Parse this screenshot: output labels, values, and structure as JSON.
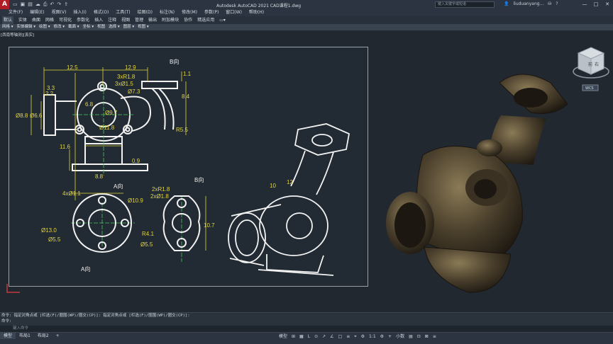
{
  "titlebar": {
    "logo": "A",
    "app_title": "Autodesk AutoCAD 2021    CAD课程1.dwg",
    "search_placeholder": "键入关键字或短语",
    "user": "liuduanyang...",
    "window_buttons": [
      "—",
      "□",
      "✕"
    ]
  },
  "menubar": {
    "items": [
      "文件(F)",
      "编辑(E)",
      "视图(V)",
      "插入(I)",
      "格式(O)",
      "工具(T)",
      "绘图(D)",
      "标注(N)",
      "修改(M)",
      "参数(P)",
      "窗口(W)",
      "帮助(H)"
    ]
  },
  "ribbon": {
    "tabs": [
      "默认",
      "实体",
      "曲面",
      "网格",
      "可视化",
      "参数化",
      "插入",
      "注释",
      "视图",
      "管理",
      "输出",
      "附加模块",
      "协作",
      "精选应用"
    ]
  },
  "toolstrip": {
    "items": [
      "网格 ▾",
      "实体编辑 ▾",
      "绘图 ▾",
      "修改 ▾",
      "截面 ▾",
      "坐标 ▾",
      "视图",
      "选择 ▾",
      "图层 ▾",
      "视图 ▾"
    ]
  },
  "viewport": {
    "label": "[西南等轴测][真实]",
    "viewcube": {
      "top": "上",
      "front": "前",
      "right": "右",
      "wcs": "WCS"
    }
  },
  "drawing": {
    "dims": {
      "d12_5": "12.5",
      "d12_9": "12.9",
      "b_view": "B向",
      "d1_1": "1.1",
      "d3xr18": "3xR1.8",
      "d3xd15": "3xØ1.5",
      "d7_3": "Ø7.3",
      "d3_3": "3.3",
      "d2_2": "2.2",
      "d6_8": "6.8",
      "d9_7": "Ø9.7",
      "d8_4": "8.4",
      "d8_8": "Ø8.8",
      "d6_6": "Ø6.6",
      "r5_5": "R5.5",
      "d11_8": "Ø11.8",
      "d11_6": "11.6",
      "d0_9": "0.9",
      "d8_8b": "8.8",
      "a_view": "A向",
      "d4xd11": "4xØ1.1",
      "d10_9": "Ø10.9",
      "d13_0": "Ø13.0",
      "d5_5": "Ø5.5",
      "a_view2": "A向",
      "d2xr18": "2xR1.8",
      "d2xd18": "2xØ1.8",
      "b_view2": "B向",
      "r4_1": "R4.1",
      "d10_7": "10.7",
      "d5_5b": "Ø5.5",
      "iso10": "10",
      "iso12": "12"
    }
  },
  "command": {
    "line1": "命令: 指定对角点或 [栏选(F)/圈围(WP)/圈交(CP)]:  指定对角点或 [栏选(F)/圈围(WP)/圈交(CP)]:",
    "line2": "命令:",
    "placeholder": "键入命令"
  },
  "statusbar": {
    "tabs": [
      "模型",
      "布局1",
      "布局2",
      "+"
    ],
    "right_items": [
      "模型",
      "⊞",
      "▦",
      "L",
      "⊙",
      "↗",
      "∠",
      "□",
      "≡",
      "⌖",
      "⚙",
      "1:1",
      "⚙",
      "+",
      "小数",
      "▤",
      "⊡",
      "⊠",
      "≡"
    ]
  },
  "colors": {
    "bg": "#212830",
    "accent": "#b11d25",
    "dim_yellow": "#e4d63a",
    "dim_green": "#47c95a",
    "outline": "#f2f2f2",
    "model": "#4a3f2c"
  }
}
